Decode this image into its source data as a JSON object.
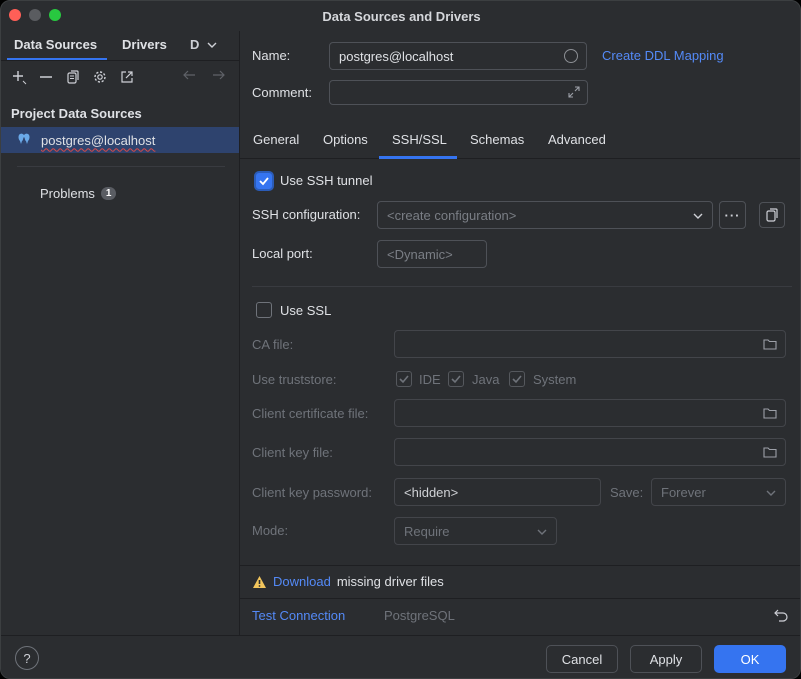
{
  "window": {
    "title": "Data Sources and Drivers"
  },
  "left": {
    "tabs": [
      "Data Sources",
      "Drivers",
      "D"
    ],
    "section_title": "Project Data Sources",
    "data_source": "postgres@localhost",
    "problems_label": "Problems",
    "problems_count": "1"
  },
  "form": {
    "name_label": "Name:",
    "name_value": "postgres@localhost",
    "create_ddl_link": "Create DDL Mapping",
    "comment_label": "Comment:",
    "comment_value": ""
  },
  "tabs": [
    "General",
    "Options",
    "SSH/SSL",
    "Schemas",
    "Advanced"
  ],
  "ssh": {
    "use_ssh_label": "Use SSH tunnel",
    "use_ssh_checked": true,
    "config_label": "SSH configuration:",
    "config_placeholder": "<create configuration>",
    "local_port_label": "Local port:",
    "local_port_placeholder": "<Dynamic>"
  },
  "ssl": {
    "use_ssl_label": "Use SSL",
    "use_ssl_checked": false,
    "ca_file_label": "CA file:",
    "truststore_label": "Use truststore:",
    "truststore_options": [
      "IDE",
      "Java",
      "System"
    ],
    "client_cert_label": "Client certificate file:",
    "client_key_label": "Client key file:",
    "client_key_password_label": "Client key password:",
    "client_key_password_value": "<hidden>",
    "save_label": "Save:",
    "save_value": "Forever",
    "mode_label": "Mode:",
    "mode_value": "Require"
  },
  "driver_warning": {
    "link": "Download",
    "text": "missing driver files"
  },
  "bottom": {
    "test_connection": "Test Connection",
    "driver_name": "PostgreSQL"
  },
  "footer": {
    "help": "?",
    "cancel": "Cancel",
    "apply": "Apply",
    "ok": "OK"
  },
  "colors": {
    "accent": "#3574f0",
    "link": "#548af7",
    "selection": "#2e436e",
    "warning": "#f2c55c"
  }
}
